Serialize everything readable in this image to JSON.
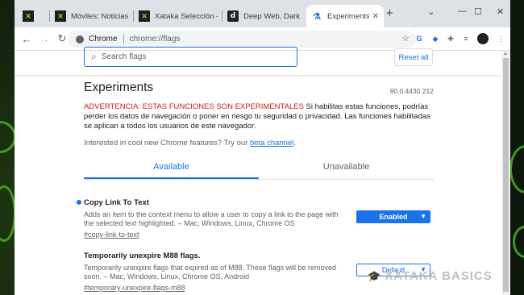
{
  "tabs": [
    {
      "favicon": "xataka-x-icon",
      "glyph": "✕",
      "label": ""
    },
    {
      "favicon": "xataka-x-icon",
      "glyph": "✕",
      "label": "Móviles: Noticias, an"
    },
    {
      "favicon": "xataka-x-icon",
      "glyph": "✕",
      "label": "Xataka Selección - l"
    },
    {
      "favicon": "d-icon",
      "glyph": "d",
      "label": "Deep Web, Dark We"
    },
    {
      "favicon": "flask-icon",
      "glyph": "⚗",
      "label": "Experiments"
    }
  ],
  "window_controls": {
    "minimize": "—",
    "maximize": "☐",
    "close": "✕"
  },
  "omnibox": {
    "site": "Chrome",
    "path": "chrome://flags"
  },
  "search": {
    "placeholder": "Search flags"
  },
  "reset_label": "Reset all",
  "page": {
    "title": "Experiments",
    "version": "90.0.4430.212",
    "warning_red": "ADVERTENCIA: ESTAS FUNCIONES SON EXPERIMENTALES",
    "warning_text": " Si habilitas estas funciones, podrías perder los datos de navegación o poner en riesgo tu seguridad o privacidad. Las funciones habilitadas se aplican a todos los usuarios de este navegador.",
    "interest_text": "Interested in cool new Chrome features? Try our ",
    "interest_link": "beta channel",
    "interest_end": "."
  },
  "filter_tabs": {
    "available": "Available",
    "unavailable": "Unavailable"
  },
  "flags": [
    {
      "name": "Copy Link To Text",
      "description": "Adds an item to the context menu to allow a user to copy a link to the page with the selected text highlighted. – Mac, Windows, Linux, Chrome OS",
      "link": "#copy-link-to-text",
      "state": "Enabled",
      "modified": true
    },
    {
      "name": "Temporarily unexpire M88 flags.",
      "description": "Temporarily unexpire flags that expired as of M88. These flags will be removed soon. – Mac, Windows, Linux, Chrome OS, Android",
      "link": "#temporary-unexpire-flags-m88",
      "state": "Default",
      "modified": false
    }
  ],
  "watermark": "XATAKA BASICS",
  "colors": {
    "accent": "#1a73e8",
    "warning": "#c5221f",
    "tabstrip": "#dee1e6"
  }
}
